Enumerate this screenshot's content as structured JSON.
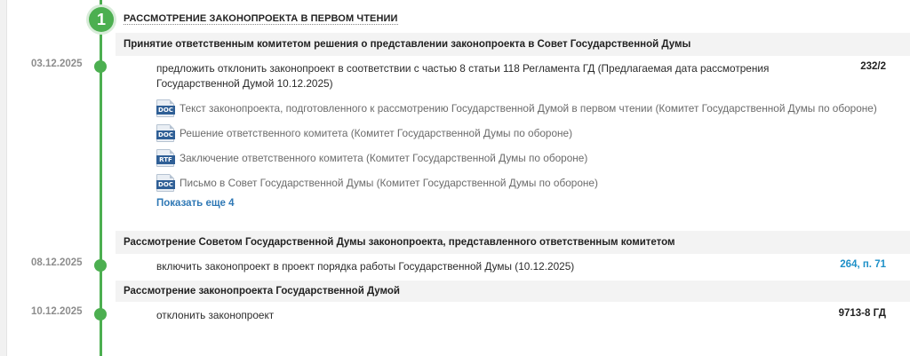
{
  "stage": {
    "number": "1",
    "title": "РАССМОТРЕНИЕ ЗАКОНОПРОЕКТА В ПЕРВОМ ЧТЕНИИ"
  },
  "sections": [
    {
      "title": "Принятие ответственным комитетом решения о представлении законопроекта в Совет Государственной Думы",
      "event": {
        "date": "03.12.2025",
        "text_line1": "предложить отклонить законопроект в соответствии с частью 8 статьи 118 Регламента ГД (Предлагаемая дата рассмотрения",
        "text_line2": "Государственной Думой 10.12.2025)",
        "number": "232/2"
      },
      "documents": [
        {
          "type": "DOC",
          "title": "Текст законопроекта, подготовленного к рассмотрению Государственной Думой в первом чтении (Комитет Государственной Думы по обороне)"
        },
        {
          "type": "DOC",
          "title": "Решение ответственного комитета (Комитет Государственной Думы по обороне)"
        },
        {
          "type": "RTF",
          "title": "Заключение ответственного комитета (Комитет Государственной Думы по обороне)"
        },
        {
          "type": "DOC",
          "title": "Письмо в Совет Государственной Думы (Комитет Государственной Думы по обороне)"
        }
      ],
      "show_more": "Показать еще 4"
    },
    {
      "title": "Рассмотрение Советом Государственной Думы законопроекта, представленного ответственным комитетом",
      "event": {
        "date": "08.12.2025",
        "text": "включить законопроект в проект порядка работы Государственной Думы (10.12.2025)",
        "number": "264, п. 71"
      }
    },
    {
      "title": "Рассмотрение законопроекта Государственной Думой",
      "event": {
        "date": "10.12.2025",
        "text": "отклонить законопроект",
        "number": "9713-8 ГД"
      }
    }
  ],
  "colors": {
    "timeline": "#4caf50",
    "link": "#1e90c8",
    "doc_tag": "#2f5f96"
  }
}
